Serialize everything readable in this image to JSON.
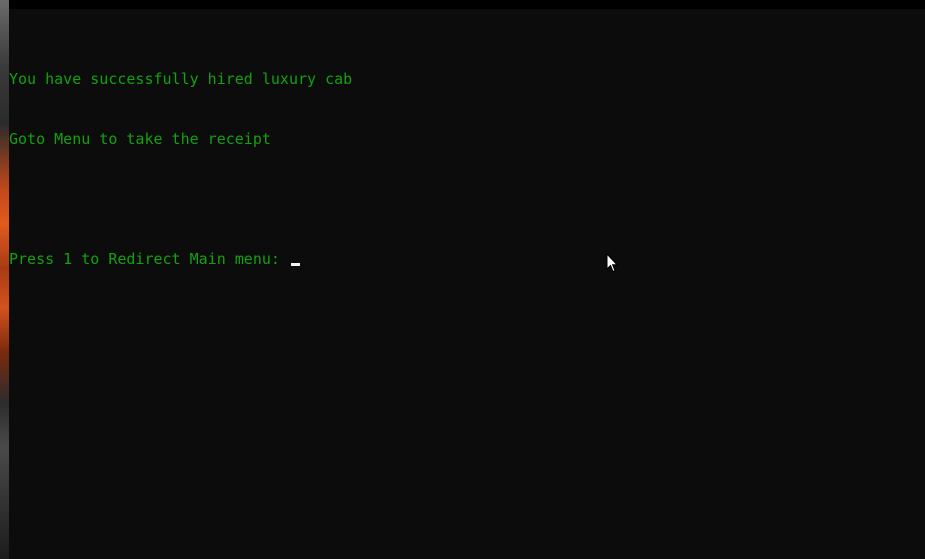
{
  "console": {
    "line_success": "You have successfully hired luxury cab",
    "line_goto": "Goto Menu to take the receipt",
    "line_blank": "",
    "prompt": "Press 1 to Redirect Main menu: ",
    "text_color": "#13a10e",
    "background_color": "#0c0c0c"
  },
  "icons": {
    "pointer": "mouse-pointer-icon",
    "cursor": "text-cursor-icon"
  }
}
